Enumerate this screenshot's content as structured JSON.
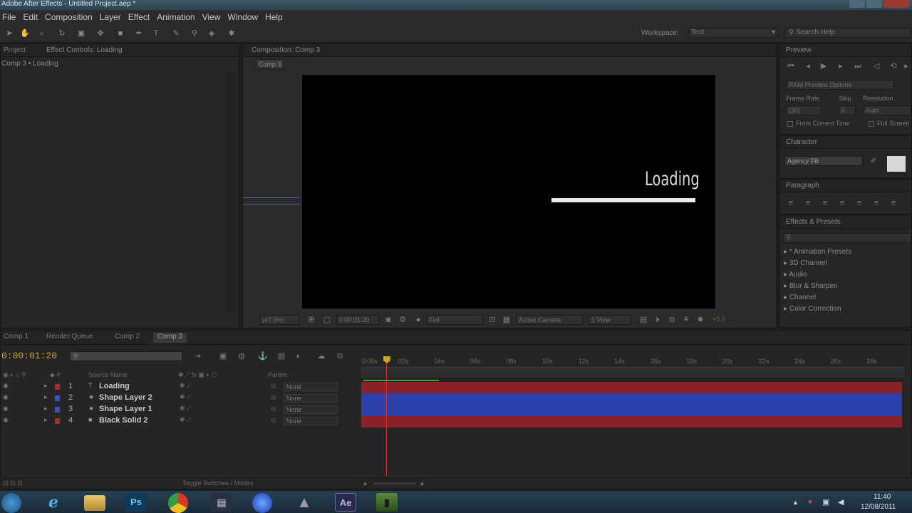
{
  "window": {
    "title": "Adobe After Effects - Untitled Project.aep *"
  },
  "menu": [
    "File",
    "Edit",
    "Composition",
    "Layer",
    "Effect",
    "Animation",
    "View",
    "Window",
    "Help"
  ],
  "toolbar": {
    "workspace_label": "Workspace:",
    "workspace_value": "Text",
    "search_placeholder": "Search Help"
  },
  "left_panel": {
    "tab_project": "Project",
    "tab_effect_controls": "Effect Controls: Loading",
    "breadcrumb": "Comp 3 • Loading"
  },
  "comp_panel": {
    "tab": "Composition: Comp 3",
    "comp_button": "Comp 3",
    "text_layer": "Loading",
    "zoom": "(47.9%)",
    "timecode": "0:00:01:20",
    "resolution": "Full",
    "camera": "Active Camera",
    "views": "1 View",
    "offset": "+0.0"
  },
  "preview": {
    "title": "Preview",
    "ram_options": "RAM Preview Options",
    "frame_rate_label": "Frame Rate",
    "skip_label": "Skip",
    "resolution_label": "Resolution",
    "frame_rate_value": "(30)",
    "skip_value": "0",
    "resolution_value": "Auto",
    "from_current": "From Current Time",
    "full_screen": "Full Screen"
  },
  "character": {
    "title": "Character",
    "font": "Agency FB"
  },
  "paragraph": {
    "title": "Paragraph"
  },
  "effects_presets": {
    "title": "Effects & Presets",
    "items": [
      "* Animation Presets",
      "3D Channel",
      "Audio",
      "Blur & Sharpen",
      "Channel",
      "Color Correction"
    ]
  },
  "timeline": {
    "tabs": [
      "Comp 1",
      "Render Queue",
      "Comp 2",
      "Comp 3"
    ],
    "current_time": "0:00:01:20",
    "col_source_name": "Source Name",
    "col_parent": "Parent",
    "ruler": [
      "0:00s",
      "02s",
      "04s",
      "06s",
      "08s",
      "10s",
      "12s",
      "14s",
      "16s",
      "18s",
      "20s",
      "22s",
      "24s",
      "26s",
      "28s"
    ],
    "layers": [
      {
        "num": "1",
        "name": "Loading",
        "parent": "None",
        "color": "#b02a2a",
        "bar_color": "#8c2127"
      },
      {
        "num": "2",
        "name": "Shape Layer 2",
        "parent": "None",
        "color": "#3a4fc8",
        "bar_color": "#2d3fa8"
      },
      {
        "num": "3",
        "name": "Shape Layer 1",
        "parent": "None",
        "color": "#3a4fc8",
        "bar_color": "#2d3fa8"
      },
      {
        "num": "4",
        "name": "Black Solid 2",
        "parent": "None",
        "color": "#b02a2a",
        "bar_color": "#8c2127"
      }
    ],
    "toggle_label": "Toggle Switches / Modes"
  },
  "taskbar": {
    "time": "11:40",
    "date": "12/08/2011",
    "apps": [
      "start",
      "internet-explorer",
      "file-explorer",
      "photoshop",
      "chrome",
      "media-player",
      "app-blue",
      "app-warning",
      "after-effects",
      "app-green"
    ]
  }
}
